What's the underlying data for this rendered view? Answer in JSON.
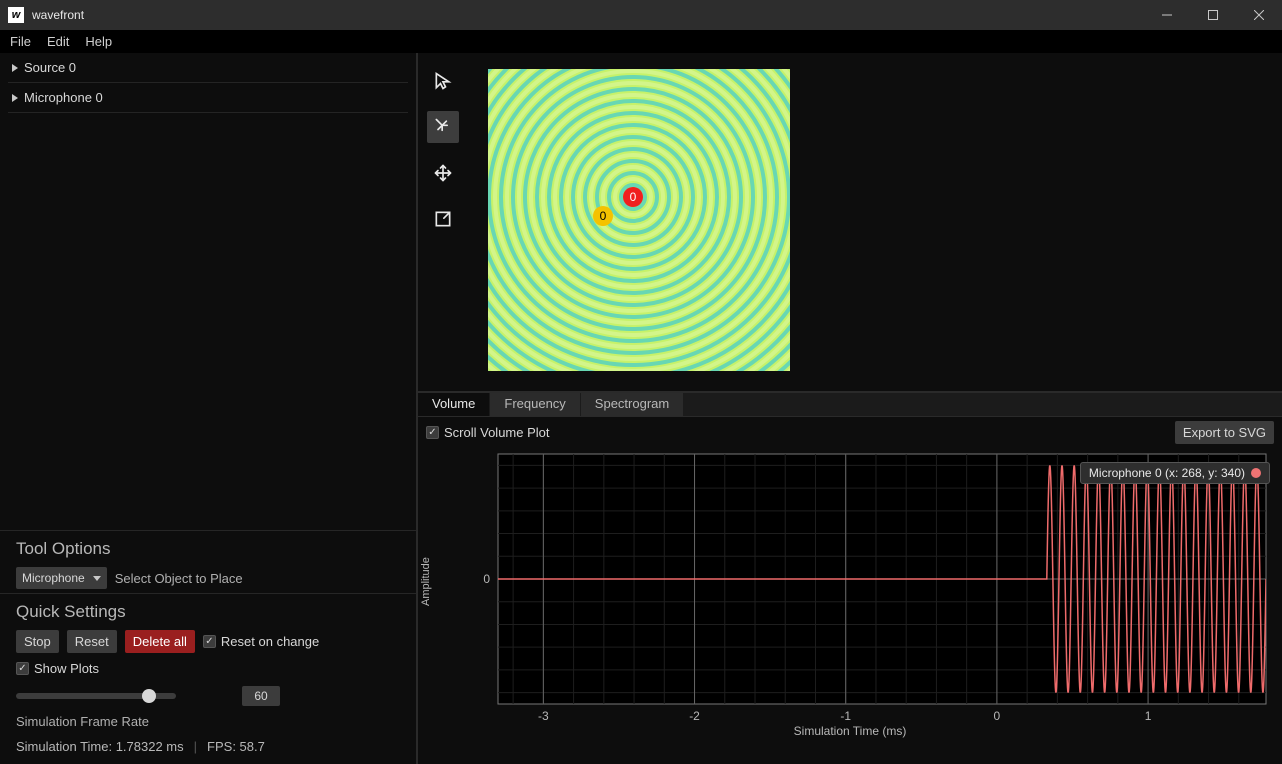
{
  "window": {
    "title": "wavefront",
    "icon_glyph": "w"
  },
  "menu": {
    "items": [
      "File",
      "Edit",
      "Help"
    ]
  },
  "tree": {
    "items": [
      {
        "label": "Source 0"
      },
      {
        "label": "Microphone 0"
      }
    ]
  },
  "tool_options": {
    "heading": "Tool Options",
    "dropdown_value": "Microphone",
    "hint": "Select Object to Place"
  },
  "quick_settings": {
    "heading": "Quick Settings",
    "stop": "Stop",
    "reset": "Reset",
    "delete_all": "Delete all",
    "reset_on_change": "Reset on change",
    "show_plots": "Show Plots",
    "frame_rate_value": "60",
    "frame_rate_label": "Simulation Frame Rate"
  },
  "status": {
    "sim_time": "Simulation Time: 1.78322 ms",
    "fps": "FPS: 58.7"
  },
  "sim": {
    "source_label": "0",
    "mic_label": "0"
  },
  "plot": {
    "tabs": [
      "Volume",
      "Frequency",
      "Spectrogram"
    ],
    "active_tab": 0,
    "scroll_label": "Scroll Volume Plot",
    "export_label": "Export to SVG",
    "legend": "Microphone 0 (x: 268, y: 340)",
    "xlabel": "Simulation Time (ms)",
    "ylabel": "Amplitude"
  },
  "chart_data": {
    "type": "line",
    "title": "",
    "xlabel": "Simulation Time (ms)",
    "ylabel": "Amplitude",
    "xlim": [
      -3.3,
      1.78
    ],
    "ylim": [
      -1.1,
      1.1
    ],
    "x_ticks": [
      -3,
      -2,
      -1,
      0,
      1
    ],
    "y_ticks": [
      0
    ],
    "series": [
      {
        "name": "Microphone 0 (x: 268, y: 340)",
        "color": "#ef6b6b",
        "segments": [
          {
            "kind": "flat",
            "x_from": -3.3,
            "x_to": 0.33,
            "y": 0
          },
          {
            "kind": "sine",
            "x_from": 0.33,
            "x_to": 1.78,
            "amplitude": 1.0,
            "cycles": 18
          }
        ]
      }
    ]
  }
}
